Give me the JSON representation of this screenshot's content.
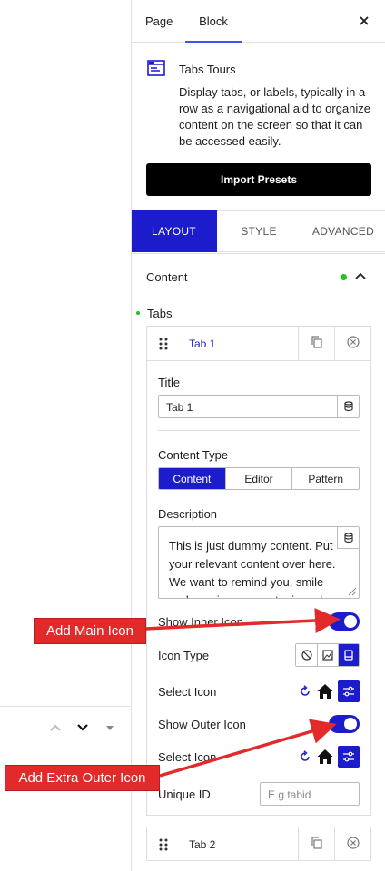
{
  "topbar": {
    "tab_page": "Page",
    "tab_block": "Block"
  },
  "block": {
    "title": "Tabs Tours",
    "description": "Display tabs, or labels, typically in a row as a navigational aid to organize content on the screen so that it can be accessed easily.",
    "import_label": "Import Presets"
  },
  "main_tabs": {
    "layout": "LAYOUT",
    "style": "STYLE",
    "advanced": "ADVANCED"
  },
  "content_section": {
    "label": "Content"
  },
  "tabs_label": "Tabs",
  "tab1": {
    "name": "Tab 1",
    "title_label": "Title",
    "title_value": "Tab 1",
    "content_type_label": "Content Type",
    "content_types": [
      "Content",
      "Editor",
      "Pattern"
    ],
    "description_label": "Description",
    "description_value": "This is just dummy content. Put your relevant content over here. We want to remind you, smile and passion are contagious, be a",
    "show_inner_icon_label": "Show Inner Icon",
    "icon_type_label": "Icon Type",
    "select_icon_label": "Select Icon",
    "show_outer_icon_label": "Show Outer Icon",
    "select_icon_outer_label": "Select Icon",
    "unique_id_label": "Unique ID",
    "unique_id_placeholder": "E.g tabid"
  },
  "tab2": {
    "name": "Tab 2"
  },
  "callouts": {
    "main": "Add Main Icon",
    "outer": "Add Extra Outer Icon"
  },
  "colors": {
    "accent": "#1c1ccc",
    "wp_blue": "#3858e9",
    "status_green": "#1fc41f",
    "callout_red": "#e22a2a"
  }
}
